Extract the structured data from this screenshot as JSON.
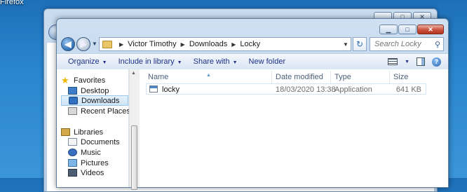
{
  "desktop": {
    "label": "Firefox"
  },
  "background_window": {
    "title": ""
  },
  "window": {
    "controls": {
      "minimize": "▁",
      "maximize": "□",
      "close": "✕"
    }
  },
  "address": {
    "crumbs": [
      "Victor Timothy",
      "Downloads",
      "Locky"
    ],
    "separator": "▶",
    "search_placeholder": "Search Locky"
  },
  "toolbar": {
    "organize": "Organize",
    "include_in_library": "Include in library",
    "share_with": "Share with",
    "new_folder": "New folder",
    "help": "?"
  },
  "nav": {
    "favorites": "Favorites",
    "desktop": "Desktop",
    "downloads": "Downloads",
    "recent_places": "Recent Places",
    "libraries": "Libraries",
    "documents": "Documents",
    "music": "Music",
    "pictures": "Pictures",
    "videos": "Videos"
  },
  "columns": {
    "name": "Name",
    "date_modified": "Date modified",
    "type": "Type",
    "size": "Size"
  },
  "files": [
    {
      "name": "locky",
      "date_modified": "18/03/2020 13:38",
      "type": "Application",
      "size": "641 KB"
    }
  ],
  "colors": {
    "accent": "#1e3287",
    "selection": "#cde4f7",
    "desktop_bg": "#2a86cf"
  },
  "icons": [
    "back-icon",
    "forward-icon",
    "refresh-icon",
    "search-icon",
    "star-icon",
    "folder-icon",
    "application-icon",
    "help-icon"
  ]
}
